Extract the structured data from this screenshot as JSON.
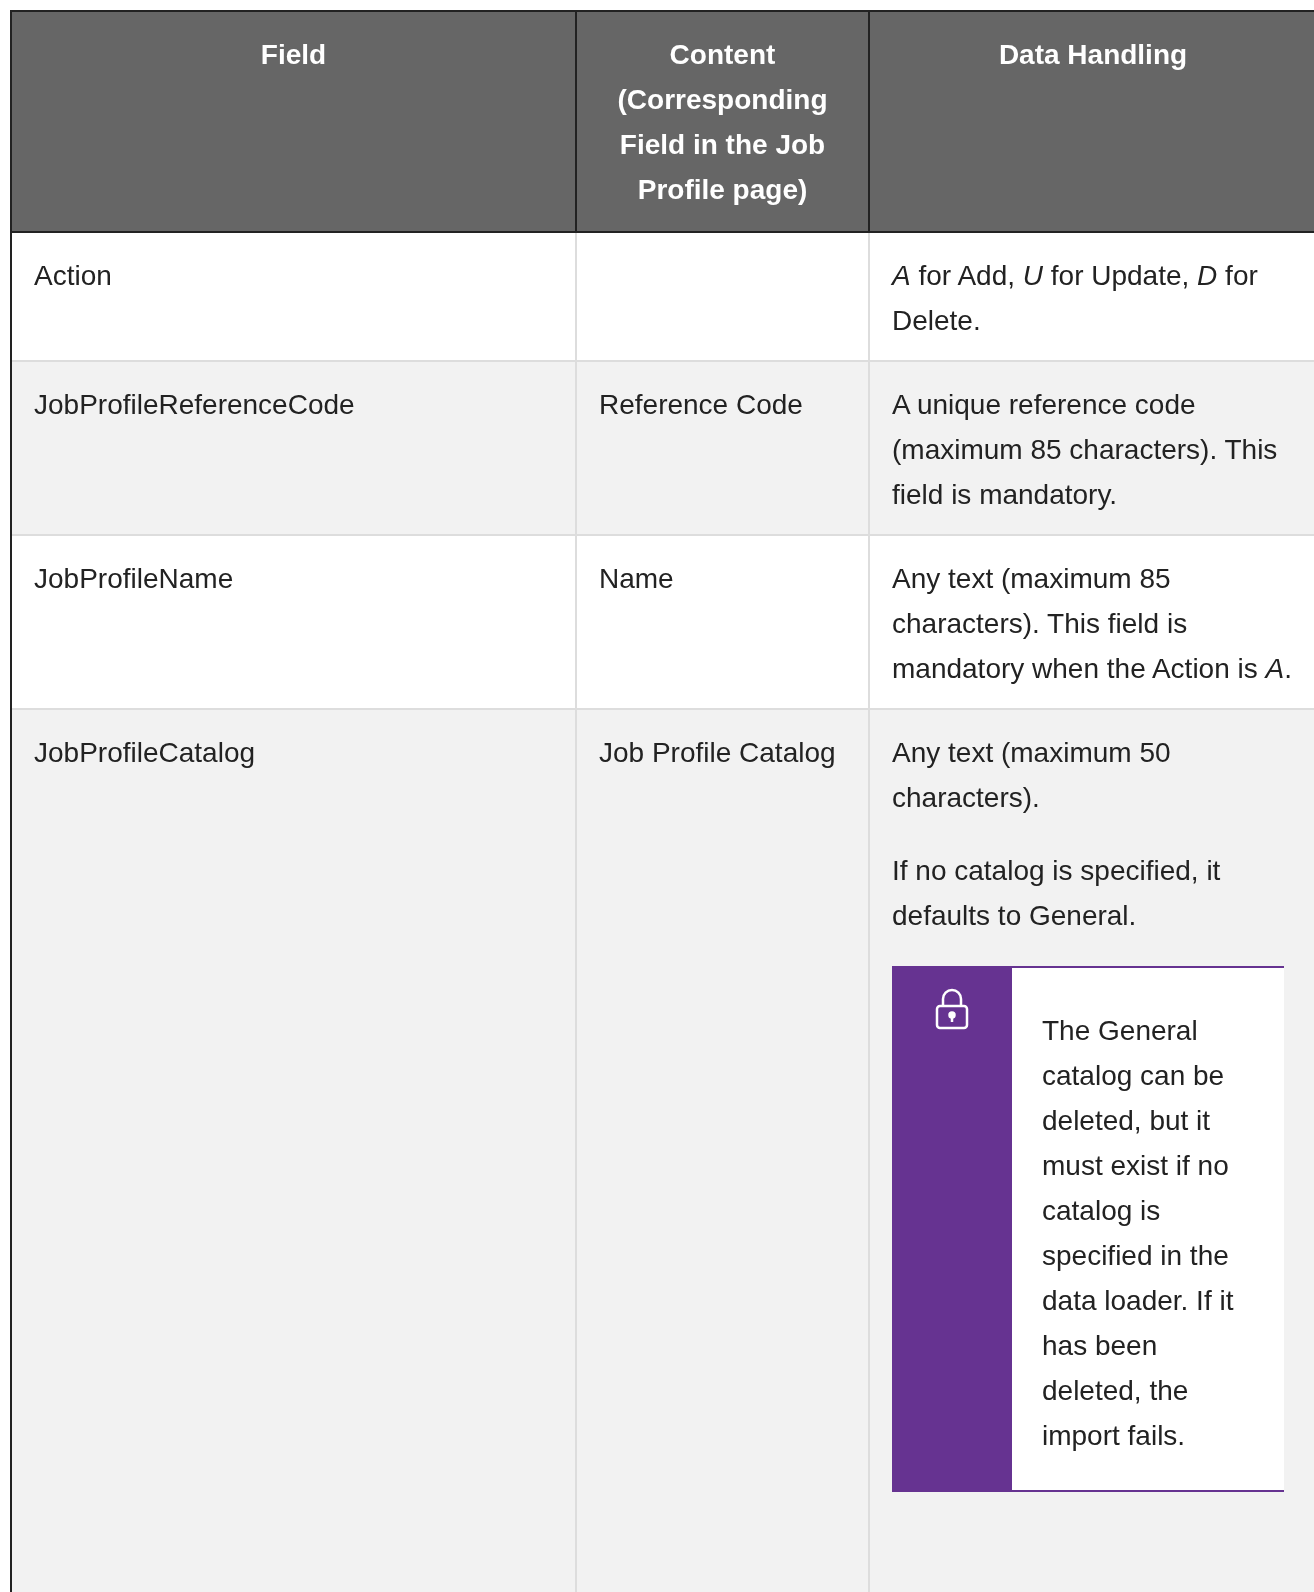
{
  "table": {
    "columns": [
      "Field",
      "Content (Corresponding Field in the Job Profile page)",
      "Data Handling"
    ],
    "rows": [
      {
        "field": "Action",
        "content": "",
        "handling": [
          "*A* for Add, *U* for Update, *D* for Delete."
        ]
      },
      {
        "field": "JobProfileReferenceCode",
        "content": "Reference Code",
        "handling": [
          "A unique reference code (maximum 85 characters). This field is mandatory."
        ]
      },
      {
        "field": "JobProfileName",
        "content": "Name",
        "handling": [
          "Any text (maximum 85 characters). This field is mandatory when the Action is *A*."
        ]
      },
      {
        "field": "JobProfileCatalog",
        "content": "Job Profile Catalog",
        "handling": [
          "Any text (maximum 50 characters).",
          "If no catalog is specified, it defaults to General."
        ],
        "note": {
          "text": "The General catalog can be deleted, but it must exist if no catalog is specified in the data loader. If it has been deleted, the import fails."
        }
      }
    ]
  }
}
